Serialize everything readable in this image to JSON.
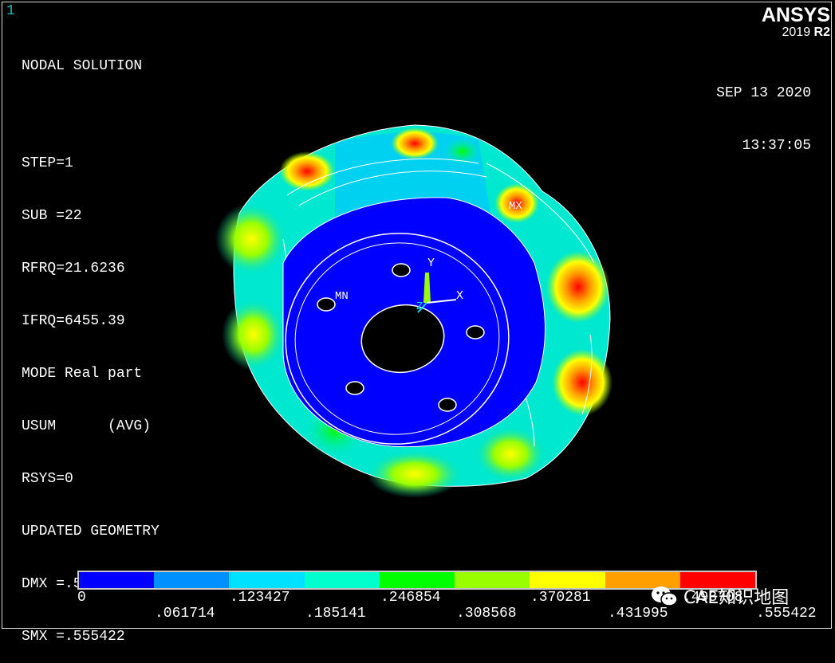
{
  "window_number": "1",
  "info_lines": [
    "NODAL SOLUTION",
    "",
    "STEP=1",
    "SUB =22",
    "RFRQ=21.6236",
    "IFRQ=6455.39",
    "MODE Real part",
    "USUM      (AVG)",
    "RSYS=0",
    "UPDATED GEOMETRY",
    "DMX =.555422",
    "SMX =.555422"
  ],
  "date": "SEP 13 2020",
  "time": "13:37:05",
  "logo": {
    "brand": "ANSYS",
    "year": "2019",
    "release": "R2"
  },
  "triad": {
    "x": "X",
    "y": "Y",
    "z": "Z"
  },
  "markers": {
    "max": "MX",
    "min": "MN"
  },
  "legend": {
    "colors": [
      "#0000ff",
      "#0080ff",
      "#00d8ff",
      "#00ffcc",
      "#00ff00",
      "#99ff00",
      "#ffff00",
      "#ffa000",
      "#ff0000"
    ],
    "upper_ticks": [
      "0",
      ".123427",
      ".246854",
      ".370281",
      ".493708"
    ],
    "lower_ticks": [
      ".061714",
      ".185141",
      ".308568",
      ".431995",
      ".555422"
    ]
  },
  "watermark": {
    "text": "CAE知识地图",
    "icon": "wechat-icon"
  },
  "colors": {
    "background": "#000000",
    "window_number": "#23b6b6"
  }
}
